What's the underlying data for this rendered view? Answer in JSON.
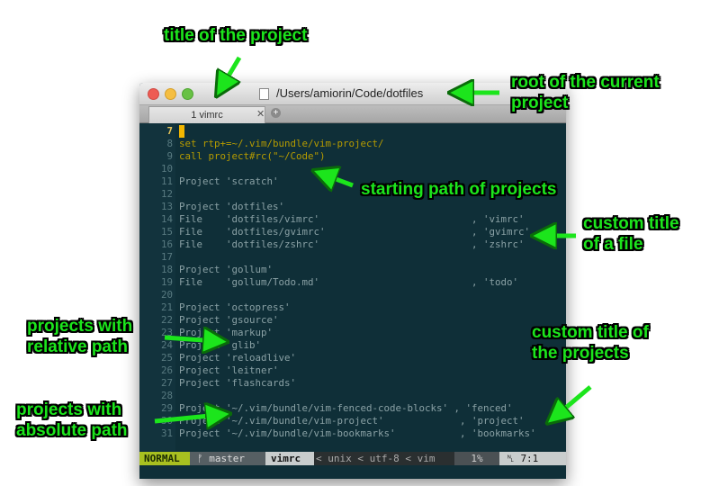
{
  "window": {
    "title": "/Users/amiorin/Code/dotfiles",
    "tabs": [
      {
        "label": "1 vimrc"
      }
    ]
  },
  "editor": {
    "lines": [
      {
        "n": "7",
        "text": ""
      },
      {
        "n": "8",
        "text": "set rtp+=~/.vim/bundle/vim-project/"
      },
      {
        "n": "9",
        "text": "call project#rc(\"~/Code\")"
      },
      {
        "n": "10",
        "text": ""
      },
      {
        "n": "11",
        "text": "Project 'scratch'"
      },
      {
        "n": "12",
        "text": ""
      },
      {
        "n": "13",
        "text": "Project 'dotfiles'"
      },
      {
        "n": "14",
        "text": "File    'dotfiles/vimrc'                          , 'vimrc'"
      },
      {
        "n": "15",
        "text": "File    'dotfiles/gvimrc'                         , 'gvimrc'"
      },
      {
        "n": "16",
        "text": "File    'dotfiles/zshrc'                          , 'zshrc'"
      },
      {
        "n": "17",
        "text": ""
      },
      {
        "n": "18",
        "text": "Project 'gollum'"
      },
      {
        "n": "19",
        "text": "File    'gollum/Todo.md'                          , 'todo'"
      },
      {
        "n": "20",
        "text": ""
      },
      {
        "n": "21",
        "text": "Project 'octopress'"
      },
      {
        "n": "22",
        "text": "Project 'gsource'"
      },
      {
        "n": "23",
        "text": "Project 'markup'"
      },
      {
        "n": "24",
        "text": "Project 'glib'"
      },
      {
        "n": "25",
        "text": "Project 'reloadlive'"
      },
      {
        "n": "26",
        "text": "Project 'leitner'"
      },
      {
        "n": "27",
        "text": "Project 'flashcards'"
      },
      {
        "n": "28",
        "text": ""
      },
      {
        "n": "29",
        "text": "Project '~/.vim/bundle/vim-fenced-code-blocks' , 'fenced'"
      },
      {
        "n": "30",
        "text": "Project '~/.vim/bundle/vim-project'             , 'project'"
      },
      {
        "n": "31",
        "text": "Project '~/.vim/bundle/vim-bookmarks'           , 'bookmarks'"
      }
    ]
  },
  "statusline": {
    "mode": "NORMAL",
    "branch": "master",
    "filename": "vimrc",
    "format": "< unix < utf-8 < vim",
    "percent": "1%",
    "position": "7:1"
  },
  "annotations": {
    "title_of_project": "title of the project",
    "root_current_project": "root of the current\nproject",
    "starting_path": "starting path of projects",
    "custom_title_file": "custom title\nof a file",
    "relative_path": "projects with\nrelative path",
    "custom_title_projects": "custom title of\nthe projects",
    "absolute_path": "projects with\nabsolute path"
  },
  "colors": {
    "annotation": "#1ce51c",
    "editor_bg": "#0f2f38",
    "mode_bg": "#a8c020",
    "cursor": "#f2b600"
  }
}
